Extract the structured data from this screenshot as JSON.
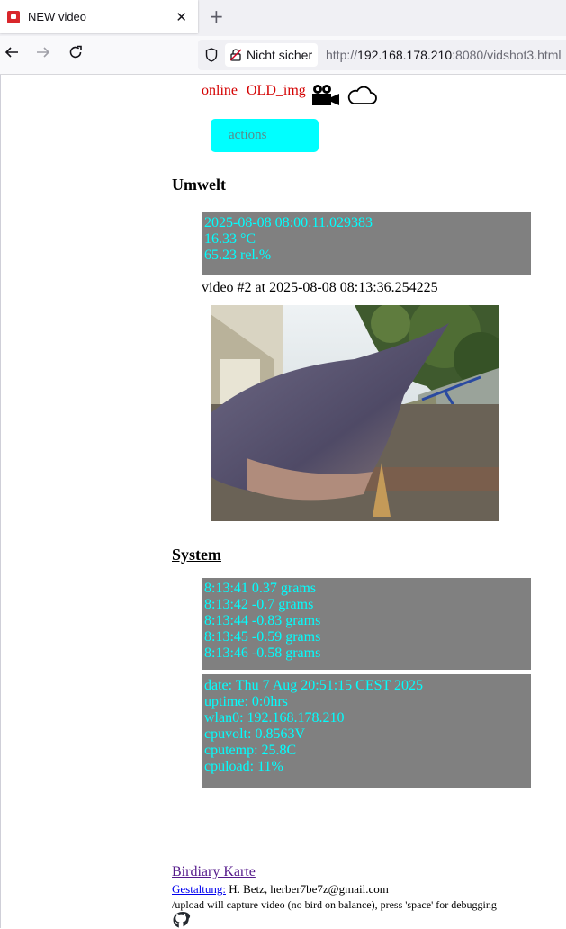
{
  "browser": {
    "tab_title": "NEW video",
    "tab_close": "✕",
    "new_tab": "+",
    "security_label": "Nicht sicher",
    "url_scheme": "http://",
    "url_host": "192.168.178.210",
    "url_rest": ":8080/vidshot3.html"
  },
  "status": {
    "online": "online",
    "old_img": "OLD_img"
  },
  "actions": {
    "label": "actions"
  },
  "umwelt": {
    "heading": "Umwelt",
    "timestamp": "2025-08-08 08:00:11.029383",
    "temperature": "16.33 °C",
    "humidity": "65.23 rel.%"
  },
  "video": {
    "caption": "video #2 at 2025-08-08 08:13:36.254225"
  },
  "system": {
    "heading": "System",
    "weights": [
      "8:13:41 0.37 grams",
      "8:13:42 -0.7 grams",
      "8:13:44 -0.83 grams",
      "8:13:45 -0.59 grams",
      "8:13:46 -0.58 grams"
    ],
    "info": [
      "date: Thu 7 Aug 20:51:15 CEST 2025",
      "uptime: 0:0hrs",
      "wlan0: 192.168.178.210",
      "cpuvolt: 0.8563V",
      "cputemp: 25.8C",
      "cpuload: 11%"
    ]
  },
  "footer": {
    "link": "Birdiary Karte",
    "credit_label": "Gestaltung:",
    "credit_text": " H. Betz, herber7be7z@gmail.com",
    "note": "/upload will capture video (no bird on balance), press 'space' for debugging"
  },
  "colors": {
    "status_red": "#d40000",
    "actions_cyan": "#00ffff",
    "box_grey": "#808080",
    "box_text": "#00ffff"
  },
  "icons": [
    "video-camera-icon",
    "cloud-icon",
    "github-icon",
    "shield-icon",
    "insecure-lock-icon"
  ]
}
